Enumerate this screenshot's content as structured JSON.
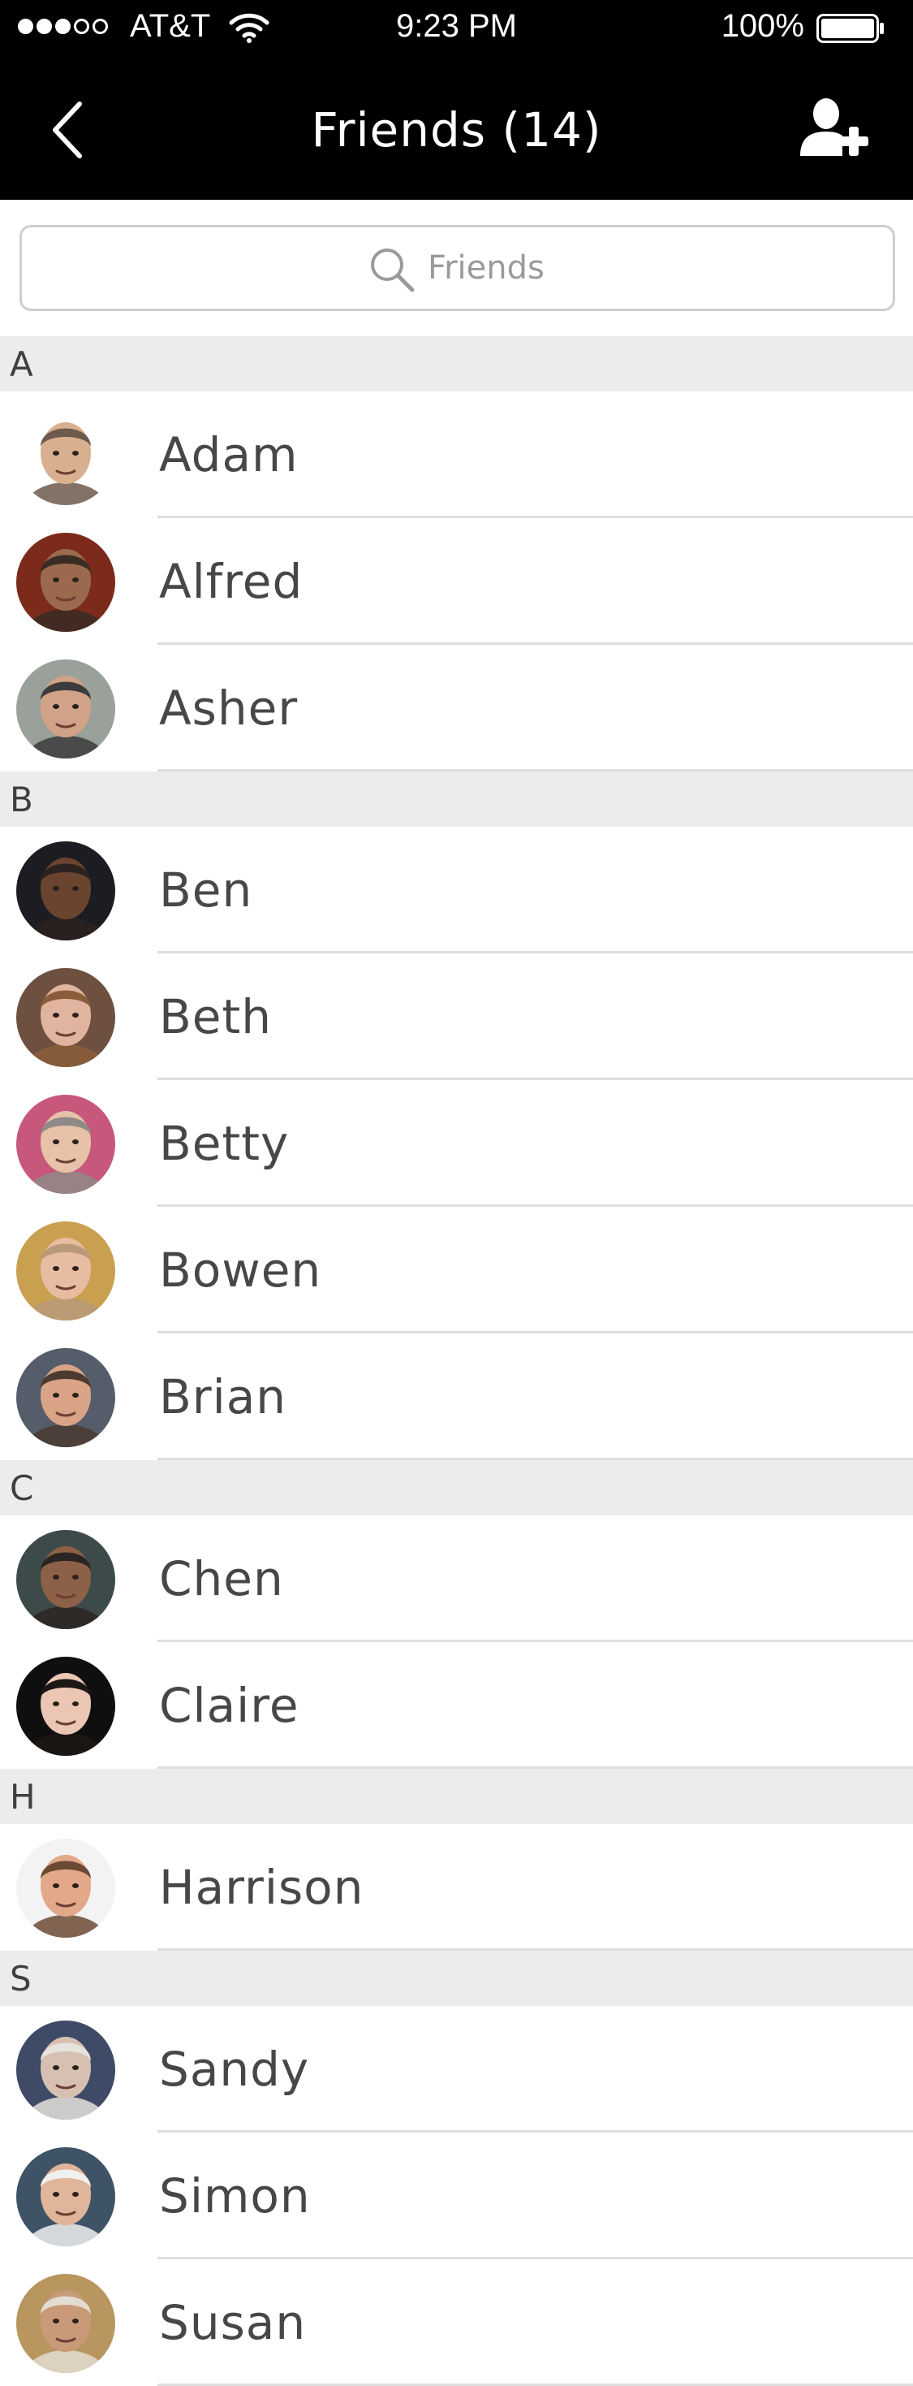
{
  "status_bar": {
    "signal_filled": 3,
    "signal_total": 5,
    "carrier": "AT&T",
    "time": "9:23 PM",
    "battery": "100%",
    "battery_level": 1.0
  },
  "nav": {
    "title": "Friends (14)",
    "back_icon": "chevron-left-icon",
    "add_icon": "add-user-icon"
  },
  "search": {
    "placeholder": "Friends",
    "value": ""
  },
  "sections": [
    {
      "letter": "A",
      "friends": [
        {
          "name": "Adam",
          "skin": "#d9b08f",
          "hair": "#6d5a4c",
          "bg": "#ffffff"
        },
        {
          "name": "Alfred",
          "skin": "#9b6a4e",
          "hair": "#3a2c24",
          "bg": "#7c2b1b"
        },
        {
          "name": "Asher",
          "skin": "#d1a287",
          "hair": "#3b3b3b",
          "bg": "#9aa09a"
        }
      ]
    },
    {
      "letter": "B",
      "friends": [
        {
          "name": "Ben",
          "skin": "#6b4430",
          "hair": "#2b2220",
          "bg": "#1b1d22"
        },
        {
          "name": "Beth",
          "skin": "#e0b49e",
          "hair": "#8a5d3a",
          "bg": "#6d5040"
        },
        {
          "name": "Betty",
          "skin": "#e7c1a8",
          "hair": "#8f8a87",
          "bg": "#c8577c"
        },
        {
          "name": "Bowen",
          "skin": "#e8bca0",
          "hair": "#b89a7a",
          "bg": "#c99f50"
        },
        {
          "name": "Brian",
          "skin": "#d9a486",
          "hair": "#4b3a30",
          "bg": "#555c6a"
        }
      ]
    },
    {
      "letter": "C",
      "friends": [
        {
          "name": "Chen",
          "skin": "#8d6048",
          "hair": "#2a2522",
          "bg": "#3d4a4a"
        },
        {
          "name": "Claire",
          "skin": "#ecc6b4",
          "hair": "#1d1715",
          "bg": "#0f0f0f"
        }
      ]
    },
    {
      "letter": "H",
      "friends": [
        {
          "name": "Harrison",
          "skin": "#e2a889",
          "hair": "#6b4a34",
          "bg": "#f3f3f3"
        }
      ]
    },
    {
      "letter": "S",
      "friends": [
        {
          "name": "Sandy",
          "skin": "#d7c0b1",
          "hair": "#e6e2dc",
          "bg": "#3e4a66"
        },
        {
          "name": "Simon",
          "skin": "#e0b599",
          "hair": "#f0f0ee",
          "bg": "#3f5366"
        },
        {
          "name": "Susan",
          "skin": "#c89a78",
          "hair": "#e3ddd1",
          "bg": "#b99560"
        }
      ]
    }
  ]
}
